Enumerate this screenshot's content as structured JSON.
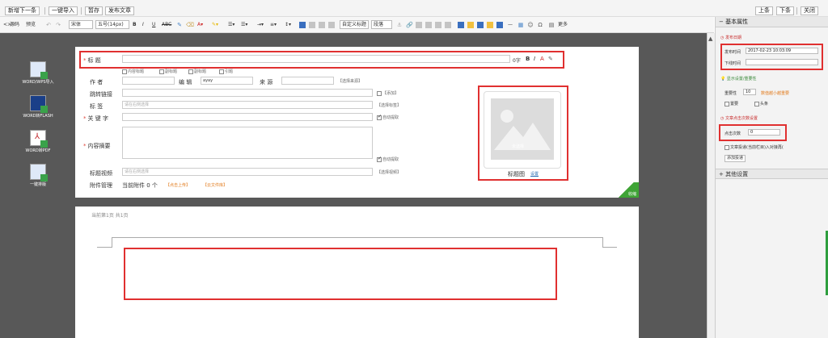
{
  "topbar": {
    "left_buttons": [
      "新增下一条",
      "一键导入",
      "暂存",
      "发布文章"
    ],
    "right_buttons": [
      "上条",
      "下条",
      "关闭"
    ]
  },
  "editor_toolbar": {
    "source_label": "源码",
    "preview_label": "预览",
    "font_family": "宋体",
    "font_size": "五号(14px)",
    "custom_heading": "自定义标题",
    "paragraph": "段落",
    "more_label": "更多"
  },
  "left_tools": [
    {
      "label": "WORD/WPS导入",
      "icon": "word-import-icon"
    },
    {
      "label": "WORD转FLASH",
      "icon": "flash-convert-icon"
    },
    {
      "label": "WORD转PDF",
      "icon": "pdf-convert-icon"
    },
    {
      "label": "一键排版",
      "icon": "one-click-layout-icon"
    }
  ],
  "form": {
    "title_label": "标 题",
    "title_right": "0字",
    "title_options": [
      "内容标题",
      "副标题",
      "副标题",
      "引题"
    ],
    "author_label": "作 者",
    "editor_label": "编 辑",
    "editor_value": "ayay",
    "source_label": "来 源",
    "source_select": "【选择来源】",
    "jump_label": "跳转链接",
    "jump_add": "【添加】",
    "tag_label": "标 签",
    "tag_placeholder": "请在右侧选择",
    "tag_select": "【选择标签】",
    "keyword_label": "关 键 字",
    "auto_extract": "自动提取",
    "summary_label": "内容摘要",
    "auto_extract2": "自动提取",
    "video_label": "标题视频",
    "video_placeholder": "请在右侧选择",
    "video_select": "【选择视频】",
    "attach_label": "附件管理",
    "attach_current": "当前附件 0 个",
    "attach_upload": "【点击上传】",
    "attach_cloud": "【云文件库】",
    "thumb_caption": "标题图",
    "thumb_settings": "设置",
    "thumb_placeholder": "未选择",
    "collapse_label": "收缩"
  },
  "page_preview": {
    "page_info": "当前第1页  共1页"
  },
  "sidebar": {
    "basic_title": "基本属性",
    "publish_section": "发布日期",
    "publish_time_label": "发布时间",
    "publish_time_value": "2017-02-23 10:03:09",
    "offline_time_label": "下线时间",
    "display_section": "显示设置/重要性",
    "importance_label": "重要性",
    "importance_value": "10",
    "importance_hint": "数值越小越重要",
    "important_label": "置要",
    "headline_label": "头条",
    "click_section": "文章点击次数设置",
    "click_label": "点击次数",
    "click_value": "0",
    "push_label": "文章投递(当前栏目)入对接再(",
    "push_button": "添加投递",
    "other_title": "其他设置"
  }
}
